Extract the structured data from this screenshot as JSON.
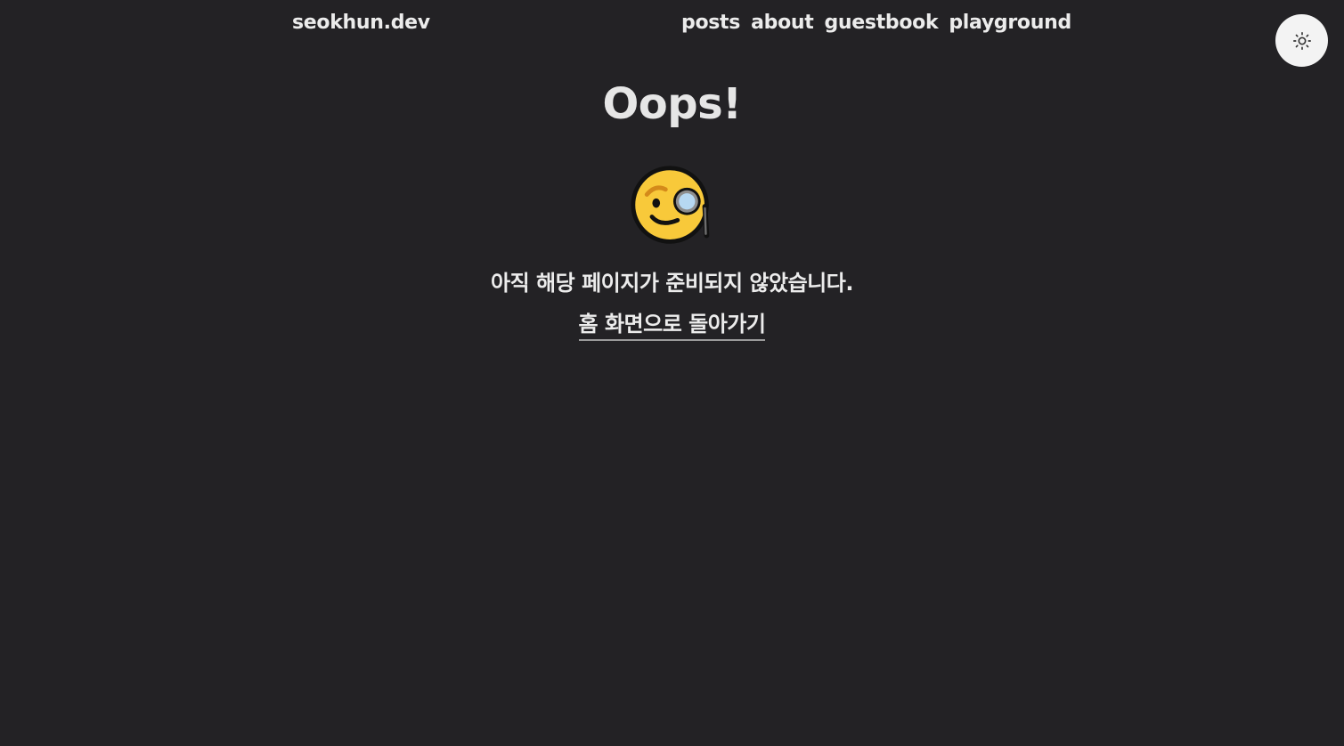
{
  "header": {
    "logo": "seokhun.dev",
    "nav": [
      "posts",
      "about",
      "guestbook",
      "playground"
    ],
    "theme_toggle_icon": "sun-icon"
  },
  "main": {
    "title": "Oops!",
    "emoji_icon": "face-with-monocle-icon",
    "message": "아직 해당 페이지가 준비되지 않았습니다.",
    "home_link": "홈 화면으로 돌아가기"
  },
  "colors": {
    "background": "#232225",
    "text": "#ececec",
    "toggle_background": "#f3f3f3"
  }
}
